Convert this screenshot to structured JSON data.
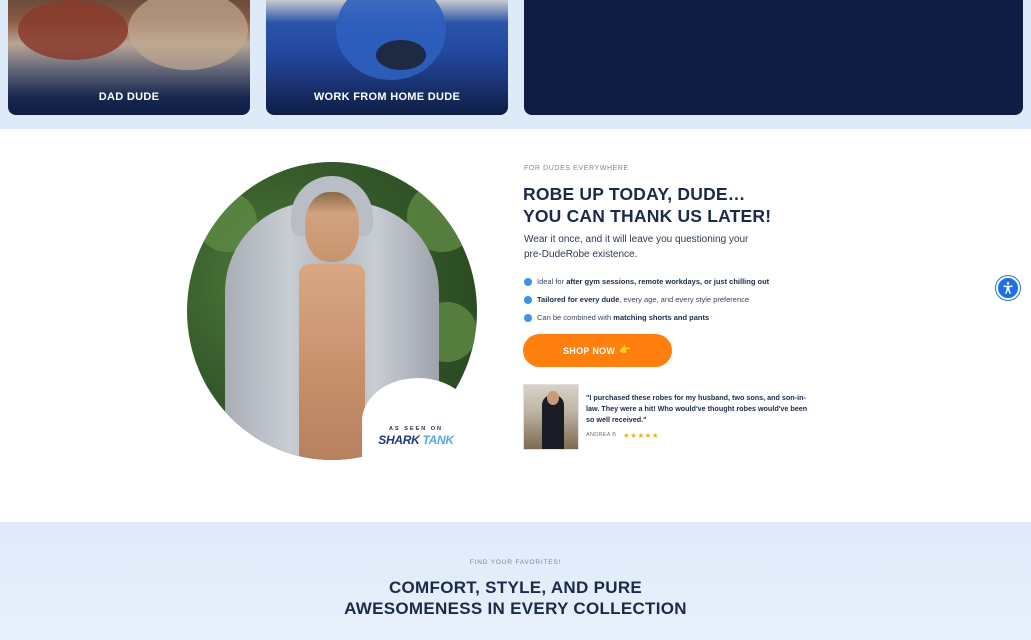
{
  "categories": [
    {
      "label": "DAD DUDE"
    },
    {
      "label": "WORK FROM HOME DUDE"
    }
  ],
  "hero": {
    "eyebrow": "FOR DUDES EVERYWHERE",
    "title_line1": "ROBE UP TODAY, DUDE…",
    "title_line2": "YOU CAN THANK US LATER!",
    "subtitle_line1": "Wear it once, and it will leave you questioning your",
    "subtitle_line2": "pre-DudeRobe existence.",
    "bullets": [
      {
        "pre": "Ideal for ",
        "bold": "after gym sessions, remote workdays, or just chilling out",
        "post": ""
      },
      {
        "pre": "",
        "bold": "Tailored for every dude",
        "post": ", every age, and every style preference"
      },
      {
        "pre": "Can be combined with ",
        "bold": "matching shorts and pants",
        "post": ""
      }
    ],
    "cta_label": "SHOP NOW",
    "cta_icon": "👉",
    "badge_seen": "AS SEEN ON",
    "badge_shark": "SHARK",
    "badge_tank": "TANK"
  },
  "review": {
    "quote": "\"I purchased these robes for my husband, two sons, and son-in-law. They were a hit! Who would've thought robes would've been so well received.\"",
    "author": "ANDREA B",
    "stars": "★★★★★",
    "rating": 5
  },
  "collections": {
    "eyebrow": "FIND YOUR FAVORITES!",
    "title_line1": "COMFORT, STYLE, AND PURE",
    "title_line2": "AWESOMENESS IN EVERY COLLECTION"
  },
  "colors": {
    "navy": "#0f1d45",
    "accent_orange": "#ff7f0f",
    "bullet_blue": "#3d8fe8",
    "band_blue": "#dfeaf9",
    "star_gold": "#f3b21b"
  },
  "icons": {
    "accessibility": "accessibility-icon",
    "cta": "pointing-hand-icon"
  }
}
